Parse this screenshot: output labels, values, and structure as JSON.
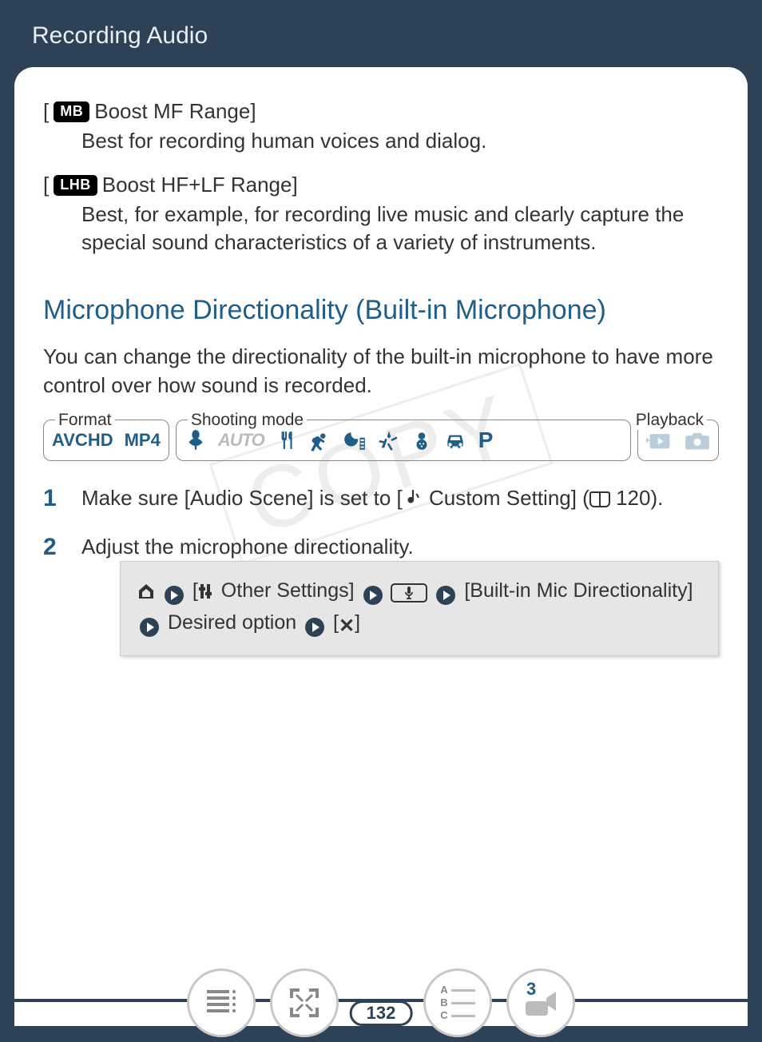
{
  "header": {
    "title": "Recording Audio"
  },
  "options": [
    {
      "badge": "MB",
      "title": "Boost MF Range]",
      "desc": "Best for recording human voices and dialog."
    },
    {
      "badge": "LHB",
      "title": "Boost HF+LF Range]",
      "desc": "Best, for example, for recording live music and clearly capture the special sound characteristics of a variety of instruments."
    }
  ],
  "section": {
    "heading": "Microphone Directionality (Built-in Microphone)",
    "intro": "You can change the directionality of the built-in microphone to have more control over how sound is recorded."
  },
  "watermark": "COPY",
  "mode_groups": {
    "format": {
      "label": "Format",
      "items": [
        "AVCHD",
        "MP4"
      ]
    },
    "shooting": {
      "label": "Shooting mode",
      "items": [
        "macro",
        "auto",
        "cutlery",
        "sports",
        "night",
        "fireworks",
        "snow",
        "car",
        "P"
      ]
    },
    "playback": {
      "label": "Playback",
      "items": [
        "video",
        "photo"
      ]
    }
  },
  "steps": {
    "s1_a": "Make sure [Audio Scene] is set to [",
    "s1_b": " Custom Setting] (",
    "s1_ref": " 120).",
    "s2": "Adjust the microphone directionality."
  },
  "navpath": {
    "item1": " Other Settings] ",
    "item2": " [Built-in Mic Directionality] ",
    "item3": " Desired option ",
    "open_bracket": " ["
  },
  "page_number": "132",
  "footer_cam_number": "3"
}
